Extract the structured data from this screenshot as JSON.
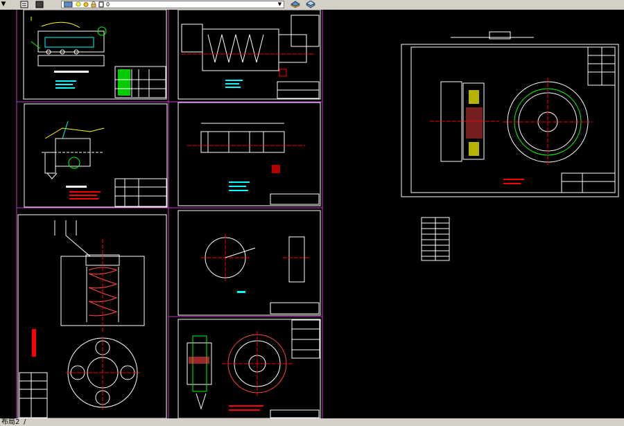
{
  "toolbar": {
    "dropdown_arrow": "▼",
    "layer_value": "0",
    "icons": [
      "layer-manager-icon",
      "layer-state-icon",
      "lightbulb-icon",
      "sun-icon",
      "lock-icon",
      "color-swatch-icon",
      "layer-previous-icon",
      "layer-tools-icon"
    ]
  },
  "layout_tabs": {
    "current": "布局2"
  },
  "colors": {
    "background": "#000000",
    "border_white": "#ffffff",
    "frame_magenta": "#cc33cc",
    "geometry_cyan": "#00ffff",
    "geometry_green": "#00ff00",
    "geometry_yellow": "#ffff00",
    "geometry_red": "#ff0000",
    "toolbar_gray": "#d4d0c8"
  }
}
